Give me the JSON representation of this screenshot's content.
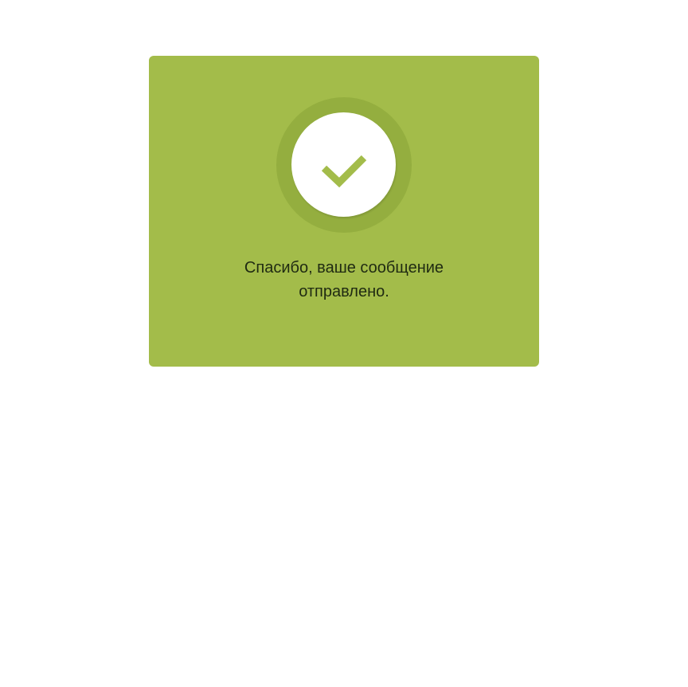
{
  "confirmation": {
    "icon": "checkmark-icon",
    "message": "Спасибо, ваше сообщение отправлено."
  },
  "colors": {
    "card_background": "#a3bc4a",
    "ring": "#94ae3f",
    "disc": "#ffffff",
    "check": "#a3bc4a",
    "text": "#1f2a12"
  }
}
